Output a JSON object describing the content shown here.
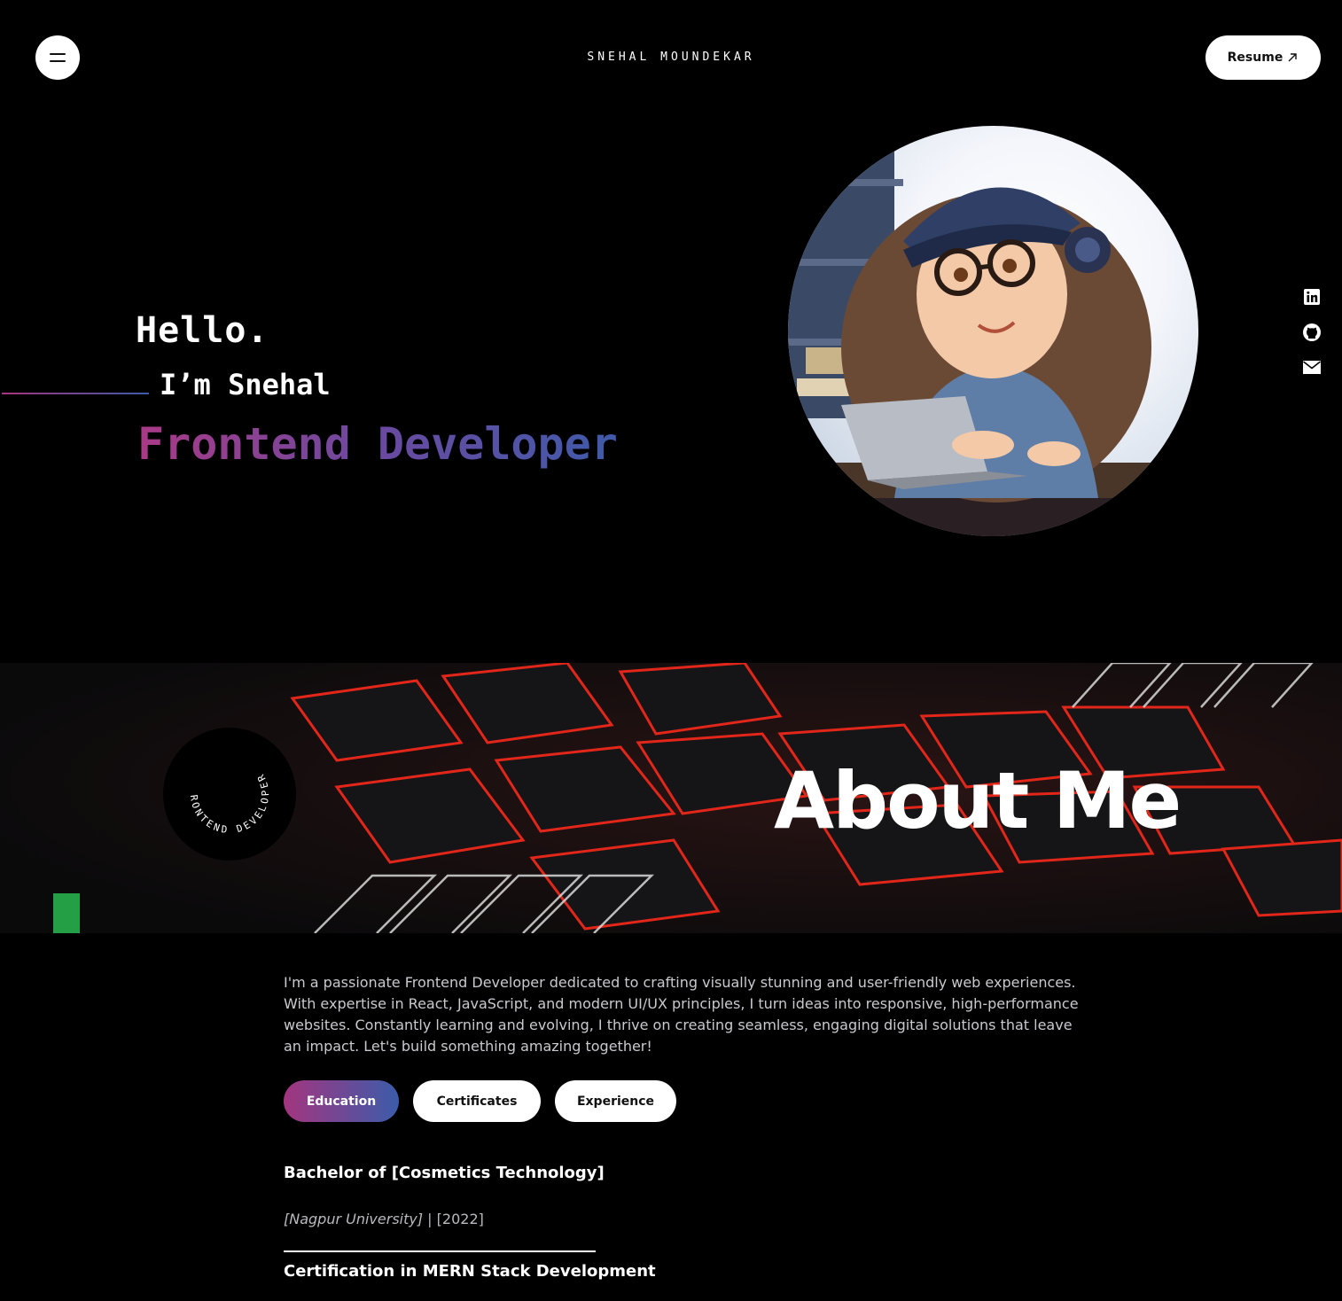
{
  "header": {
    "brand": "SNEHAL MOUNDEKAR",
    "resume_label": "Resume"
  },
  "hero": {
    "greeting": "Hello.",
    "intro": "I’m Snehal",
    "role": "Frontend Developer",
    "gradient_colors": [
      "#a93a86",
      "#3f5aa9"
    ]
  },
  "social": [
    "linkedin-icon",
    "github-icon",
    "mail-icon"
  ],
  "about": {
    "title": "About Me",
    "badge_text": "FRONTEND DEVELOPER",
    "paragraph": "I'm a passionate Frontend Developer dedicated to crafting visually stunning and user-friendly web experiences. With expertise in React, JavaScript, and modern UI/UX principles, I turn ideas into responsive, high-performance websites. Constantly learning and evolving, I thrive on creating seamless, engaging digital solutions that leave an impact. Let's build something amazing together!"
  },
  "tabs": {
    "education": "Education",
    "certificates": "Certificates",
    "experience": "Experience",
    "active": "Education"
  },
  "education": {
    "degree": "Bachelor of [Cosmetics Technology]",
    "university": "[Nagpur University]",
    "separator": " | ",
    "year": "[2022]",
    "certification": "Certification in MERN Stack Development"
  }
}
